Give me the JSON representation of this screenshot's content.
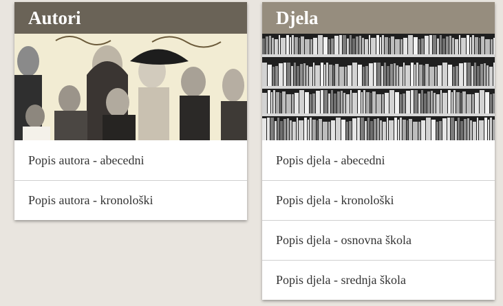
{
  "authors_card": {
    "title": "Autori",
    "image": "authors-collage-photo",
    "links": [
      {
        "label": "Popis autora - abecedni"
      },
      {
        "label": "Popis autora - kronološki"
      }
    ]
  },
  "works_card": {
    "title": "Djela",
    "image": "bookshelf-photo",
    "links": [
      {
        "label": "Popis djela - abecedni"
      },
      {
        "label": "Popis djela - kronološki"
      },
      {
        "label": "Popis djela - osnovna škola"
      },
      {
        "label": "Popis djela - srednja škola"
      }
    ]
  },
  "colors": {
    "page_background": "#e9e5df",
    "authors_header": "#6a6357",
    "works_header": "#968d7e",
    "link_text": "#333333"
  }
}
